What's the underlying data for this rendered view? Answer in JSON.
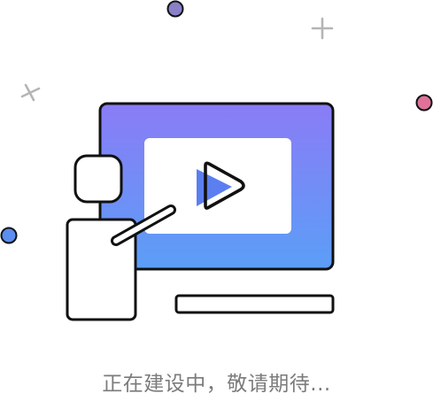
{
  "empty_state": {
    "message": "正在建设中，敬请期待...",
    "illustration": {
      "subject": "presenter-pointing-at-video-screen",
      "screen_gradient": [
        "#8a7cf6",
        "#5b9ef7"
      ],
      "play_icon_accent": "#5b7ff0",
      "outline_color": "#111111",
      "decorations": {
        "dot_colors": [
          "#8a80c8",
          "#e0729a",
          "#5b8ef0"
        ],
        "cross_color": "#b5b5b5"
      }
    }
  }
}
